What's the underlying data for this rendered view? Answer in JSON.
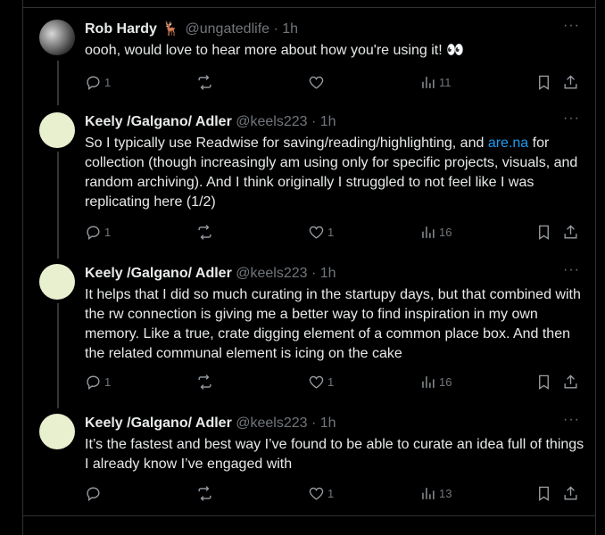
{
  "tweets": [
    {
      "name": "Rob Hardy",
      "name_emoji": "🦌",
      "handle": "@ungatedlife",
      "time": "· 1h",
      "text_before": "oooh, would love to hear more about how you're using it! ",
      "text_emoji": "👀",
      "text_link": "",
      "text_after": "",
      "replies": "1",
      "retweets": "",
      "likes": "",
      "views": "11"
    },
    {
      "name": "Keely /Galgano/ Adler",
      "name_emoji": "",
      "handle": "@keels223",
      "time": "· 1h",
      "text_before": "So I typically use Readwise for saving/reading/highlighting, and ",
      "text_emoji": "",
      "text_link": "are.na",
      "text_after": " for collection (though increasingly am using only for specific projects, visuals, and random archiving). And I think originally I struggled to not feel like I was replicating here (1/2)",
      "replies": "1",
      "retweets": "",
      "likes": "1",
      "views": "16"
    },
    {
      "name": "Keely /Galgano/ Adler",
      "name_emoji": "",
      "handle": "@keels223",
      "time": "· 1h",
      "text_before": "It helps that I did so much curating in the startupy days, but that combined with the rw connection is giving me a better way to find inspiration in my own memory. Like a true, crate digging element of a common place box. And then the related communal element is icing on the cake",
      "text_emoji": "",
      "text_link": "",
      "text_after": "",
      "replies": "1",
      "retweets": "",
      "likes": "1",
      "views": "16"
    },
    {
      "name": "Keely /Galgano/ Adler",
      "name_emoji": "",
      "handle": "@keels223",
      "time": "· 1h",
      "text_before": "It’s the fastest and best way I’ve found to be able to curate an idea full of things I already know I’ve engaged with",
      "text_emoji": "",
      "text_link": "",
      "text_after": "",
      "replies": "",
      "retweets": "",
      "likes": "1",
      "views": "13"
    }
  ],
  "more_label": "···",
  "icons": {
    "reply": "reply-icon",
    "retweet": "retweet-icon",
    "like": "heart-icon",
    "views": "views-icon",
    "bookmark": "bookmark-icon",
    "share": "share-icon"
  },
  "colors": {
    "link": "#1d9bf0",
    "muted": "#71767b",
    "text": "#e7e9ea",
    "background": "#000000"
  }
}
